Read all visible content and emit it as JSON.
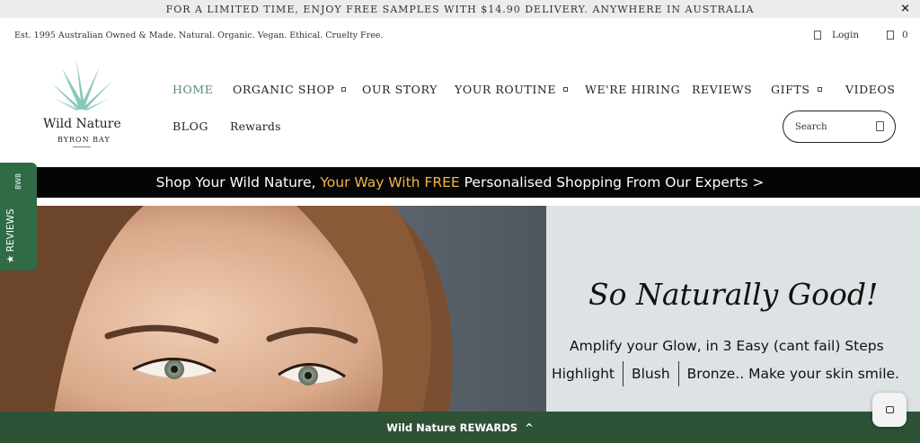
{
  "announcement": {
    "text": "FOR A LIMITED TIME, ENJOY FREE SAMPLES WITH $14.90 DELIVERY. ANYWHERE IN AUSTRALIA",
    "close": "×"
  },
  "utility": {
    "tagline": "Est. 1995 Australian Owned & Made. Natural. Organic. Vegan. Ethical. Cruelty Free.",
    "login": "Login",
    "cart_count": "0"
  },
  "brand": {
    "name": "Wild Nature",
    "location": "BYRON BAY",
    "leaf_color": "#7fc3b3"
  },
  "nav": {
    "home": "HOME",
    "organic_shop": "ORGANIC SHOP",
    "our_story": "OUR STORY",
    "your_routine": "YOUR ROUTINE",
    "hiring": "WE'RE HIRING",
    "reviews": "REVIEWS",
    "gifts": "GIFTS",
    "videos": "VIDEOS",
    "blog": "BLOG",
    "rewards": "Rewards"
  },
  "search": {
    "placeholder": "Search"
  },
  "promo": {
    "part1": "Shop Your Wild Nature, ",
    "part2": "Your Way With FREE",
    "part3": " Personalised Shopping From Our Experts >",
    "highlight_color": "#f2b544"
  },
  "hero": {
    "title": "So Naturally Good!",
    "subtitle": "Amplify your Glow, in 3 Easy (cant fail) Steps",
    "step1": "Highlight",
    "step2": "Blush",
    "step3": "Bronze.. Make your skin smile."
  },
  "reviews_tab": {
    "label": "★ REVIEWS",
    "count": "8W8"
  },
  "rewards_bar": {
    "label": "Wild Nature REWARDS",
    "chevron": "^"
  },
  "colors": {
    "accent_green": "#2d5236",
    "nav_active": "#5b8a6e"
  }
}
